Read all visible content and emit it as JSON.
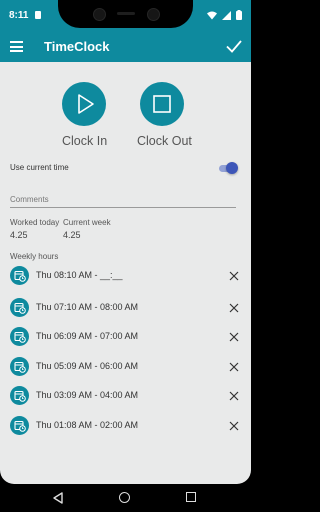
{
  "status_bar": {
    "time": "8:11"
  },
  "app_bar": {
    "title": "TimeClock"
  },
  "actions": {
    "clock_in_label": "Clock In",
    "clock_out_label": "Clock Out"
  },
  "settings": {
    "use_current_time_label": "Use current time",
    "use_current_time_on": true
  },
  "comments": {
    "placeholder": "Comments",
    "value": ""
  },
  "summary": {
    "worked_today_label": "Worked today",
    "worked_today_value": "4.25",
    "current_week_label": "Current week",
    "current_week_value": "4.25"
  },
  "weekly": {
    "label": "Weekly hours",
    "entries": [
      {
        "text": "Thu 08:10 AM - __:__"
      },
      {
        "text": "Thu 07:10 AM - 08:00 AM"
      },
      {
        "text": "Thu 06:09 AM - 07:00 AM"
      },
      {
        "text": "Thu 05:09 AM - 06:00 AM"
      },
      {
        "text": "Thu 03:09 AM - 04:00 AM"
      },
      {
        "text": "Thu 01:08 AM - 02:00 AM"
      }
    ]
  },
  "icons": {
    "menu": "menu-icon",
    "confirm": "check-icon",
    "clock_in": "play-icon",
    "clock_out": "stop-icon",
    "entry": "calendar-clock-icon",
    "delete": "close-icon"
  },
  "colors": {
    "accent": "#0e8a9e",
    "switch_on": "#3d56b8",
    "background": "#e9eaea"
  }
}
